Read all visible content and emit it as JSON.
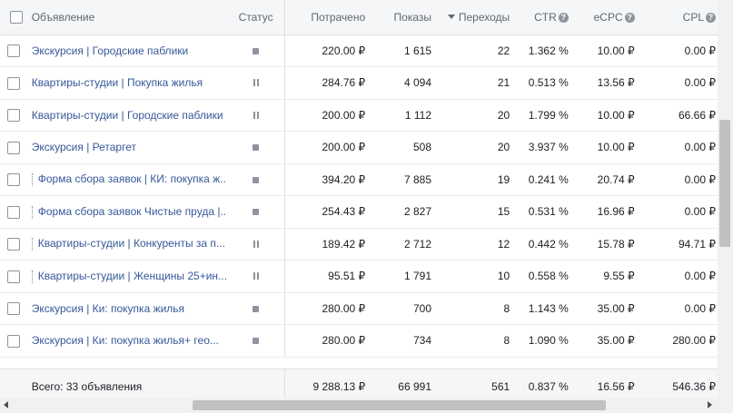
{
  "header": {
    "ad": "Объявление",
    "status": "Статус",
    "spent": "Потрачено",
    "shows": "Показы",
    "clicks": "Переходы",
    "ctr": "CTR",
    "ecpc": "eCPC",
    "cpl": "CPL",
    "info_glyph": "?"
  },
  "rows": [
    {
      "name": "Экскурсия | Городские паблики",
      "status": "stopped",
      "spent": "220.00 ₽",
      "shows": "1 615",
      "clicks": "22",
      "ctr": "1.362 %",
      "ecpc": "10.00 ₽",
      "cpl": "0.00 ₽"
    },
    {
      "name": "Квартиры-студии | Покупка жилья",
      "status": "paused",
      "spent": "284.76 ₽",
      "shows": "4 094",
      "clicks": "21",
      "ctr": "0.513 %",
      "ecpc": "13.56 ₽",
      "cpl": "0.00 ₽"
    },
    {
      "name": "Квартиры-студии | Городские паблики",
      "status": "paused",
      "spent": "200.00 ₽",
      "shows": "1 112",
      "clicks": "20",
      "ctr": "1.799 %",
      "ecpc": "10.00 ₽",
      "cpl": "66.66 ₽"
    },
    {
      "name": "Экскурсия | Ретаргет",
      "status": "stopped",
      "spent": "200.00 ₽",
      "shows": "508",
      "clicks": "20",
      "ctr": "3.937 %",
      "ecpc": "10.00 ₽",
      "cpl": "0.00 ₽"
    },
    {
      "name": "Форма сбора заявок | КИ: покупка ж...",
      "status": "stopped",
      "spent": "394.20 ₽",
      "shows": "7 885",
      "clicks": "19",
      "ctr": "0.241 %",
      "ecpc": "20.74 ₽",
      "cpl": "0.00 ₽"
    },
    {
      "name": "Форма сбора заявок Чистые пруда |...",
      "status": "stopped",
      "spent": "254.43 ₽",
      "shows": "2 827",
      "clicks": "15",
      "ctr": "0.531 %",
      "ecpc": "16.96 ₽",
      "cpl": "0.00 ₽"
    },
    {
      "name": "Квартиры-студии | Конкуренты за п...",
      "status": "paused",
      "spent": "189.42 ₽",
      "shows": "2 712",
      "clicks": "12",
      "ctr": "0.442 %",
      "ecpc": "15.78 ₽",
      "cpl": "94.71 ₽"
    },
    {
      "name": "Квартиры-студии | Женщины 25+ин...",
      "status": "paused",
      "spent": "95.51 ₽",
      "shows": "1 791",
      "clicks": "10",
      "ctr": "0.558 %",
      "ecpc": "9.55 ₽",
      "cpl": "0.00 ₽"
    },
    {
      "name": "Экскурсия | Ки: покупка жилья",
      "status": "stopped",
      "spent": "280.00 ₽",
      "shows": "700",
      "clicks": "8",
      "ctr": "1.143 %",
      "ecpc": "35.00 ₽",
      "cpl": "0.00 ₽"
    },
    {
      "name": "Экскурсия | Ки: покупка жилья+ гео...",
      "status": "stopped",
      "spent": "280.00 ₽",
      "shows": "734",
      "clicks": "8",
      "ctr": "1.090 %",
      "ecpc": "35.00 ₽",
      "cpl": "280.00 ₽"
    }
  ],
  "totals": {
    "label": "Всего: 33 объявления",
    "spent": "9 288.13 ₽",
    "shows": "66 991",
    "clicks": "561",
    "ctr": "0.837 %",
    "ecpc": "16.56 ₽",
    "cpl": "546.36 ₽"
  }
}
